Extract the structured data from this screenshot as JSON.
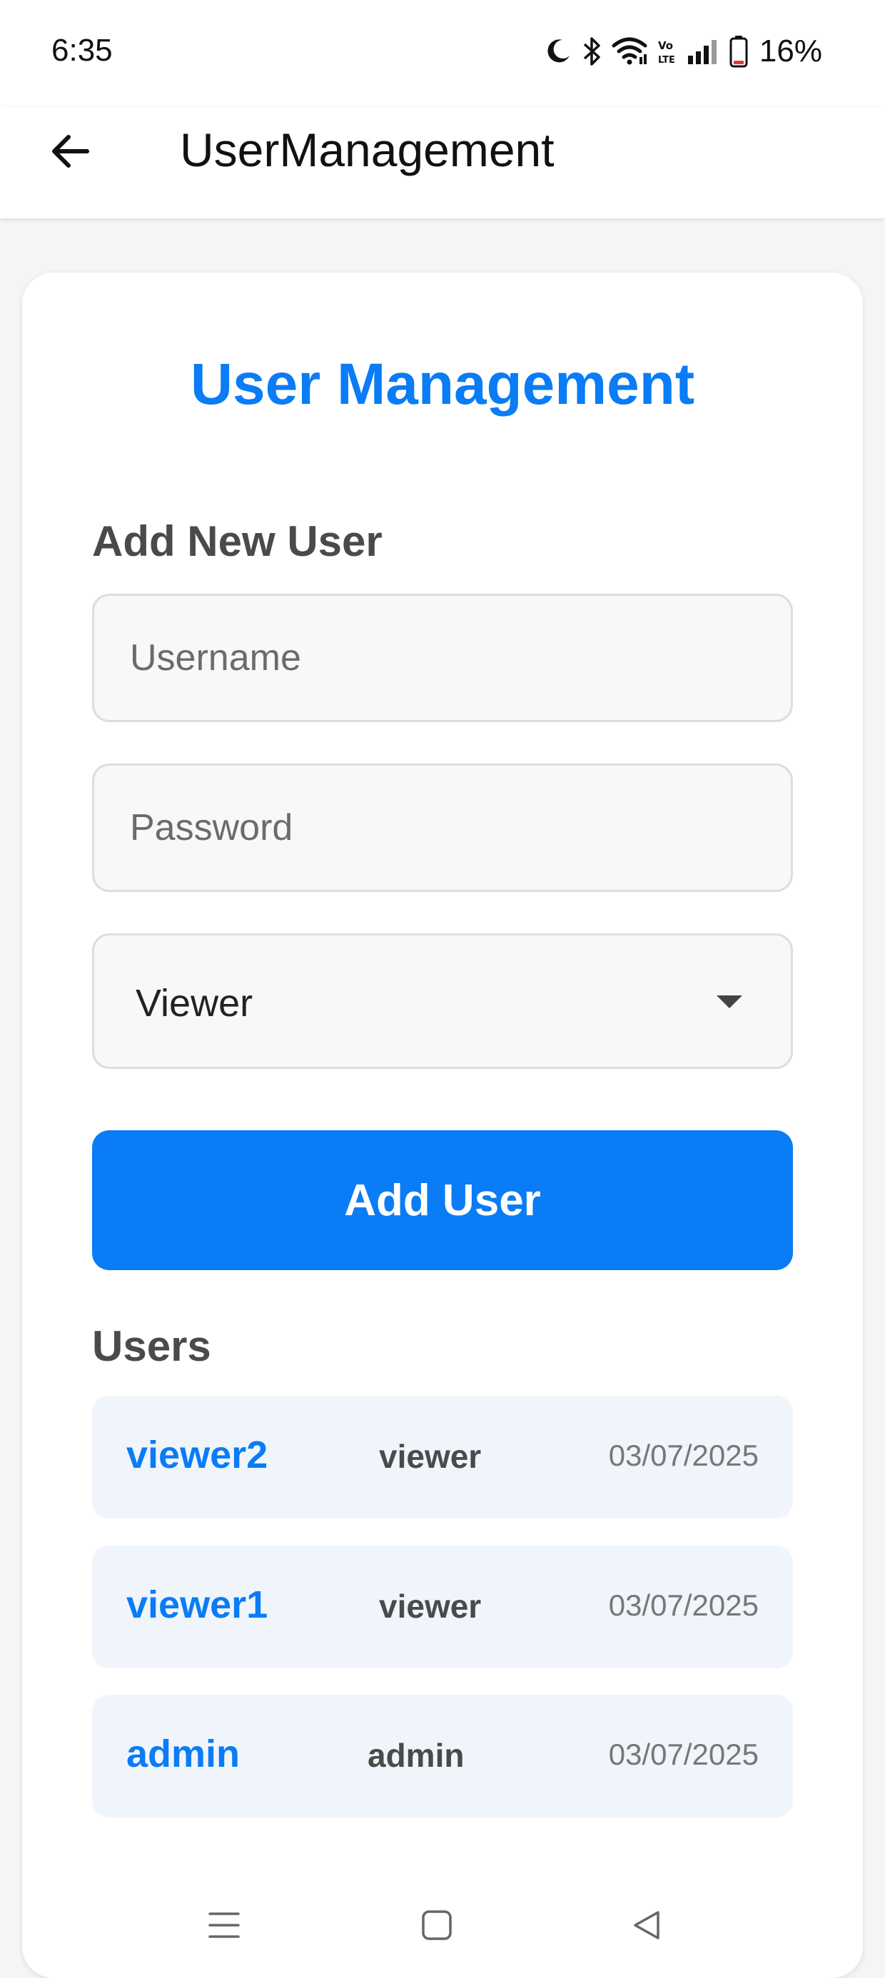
{
  "status_bar": {
    "time": "6:35",
    "battery": "16%",
    "icons": [
      "moon-icon",
      "bluetooth-icon",
      "wifi-icon",
      "volte-icon",
      "signal-icon",
      "battery-icon"
    ]
  },
  "app_bar": {
    "title": "UserManagement",
    "back_icon": "arrow-left-icon"
  },
  "card": {
    "title": "User Management",
    "add_section": {
      "label": "Add New User",
      "username_placeholder": "Username",
      "password_placeholder": "Password",
      "role_selected": "Viewer",
      "add_button_label": "Add User"
    },
    "users_section": {
      "label": "Users",
      "users": [
        {
          "name": "viewer2",
          "role": "viewer",
          "date": "03/07/2025"
        },
        {
          "name": "viewer1",
          "role": "viewer",
          "date": "03/07/2025"
        },
        {
          "name": "admin",
          "role": "admin",
          "date": "03/07/2025"
        }
      ]
    }
  },
  "nav_bar": {
    "icons": [
      "menu-icon",
      "home-square-icon",
      "back-triangle-icon"
    ]
  },
  "colors": {
    "accent": "#0a7cf5",
    "row_bg": "#f0f4fb",
    "page_bg": "#f4f5f7"
  }
}
